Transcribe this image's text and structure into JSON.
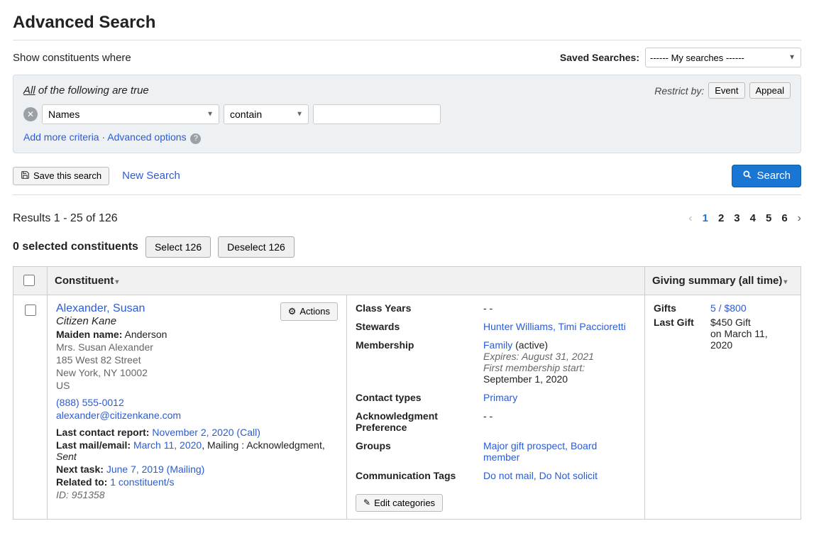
{
  "header": {
    "title": "Advanced Search",
    "show_label": "Show constituents where",
    "saved_label": "Saved Searches:",
    "saved_placeholder": "------ My searches ------"
  },
  "criteria": {
    "all_text_prefix": "All",
    "all_text_rest": " of the following are true",
    "restrict_label": "Restrict by:",
    "restrict_event": "Event",
    "restrict_appeal": "Appeal",
    "field": "Names",
    "operator": "contain",
    "value": "",
    "add_more": "Add more criteria",
    "adv_options": "Advanced options"
  },
  "actions": {
    "save_search": "Save this search",
    "new_search": "New Search",
    "search": "Search"
  },
  "results": {
    "summary": "Results 1 - 25 of 126",
    "pages": [
      "1",
      "2",
      "3",
      "4",
      "5",
      "6"
    ],
    "current_page": "1",
    "selected_count_label": "0 selected constituents",
    "select_all": "Select 126",
    "deselect_all": "Deselect 126"
  },
  "table": {
    "col_constituent": "Constituent",
    "col_giving": "Giving summary (all time)"
  },
  "row1": {
    "name": "Alexander, Susan",
    "org": "Citizen Kane",
    "maiden_label": "Maiden name:",
    "maiden_value": "Anderson",
    "salutation": "Mrs. Susan Alexander",
    "addr1": "185 West 82 Street",
    "addr2": "New York, NY 10002",
    "addr3": "US",
    "phone": "(888) 555-0012",
    "email": "alexander@citizenkane.com",
    "lcr_label": "Last contact report:",
    "lcr_value": "November 2, 2020 (Call)",
    "lme_label": "Last mail/email:",
    "lme_date": "March 11, 2020",
    "lme_rest": ", Mailing : Acknowledgment, ",
    "lme_status": "Sent",
    "nt_label": "Next task:",
    "nt_value": "June 7, 2019 (Mailing)",
    "rel_label": "Related to:",
    "rel_value": "1 constituent/s",
    "id_label": "ID: 951358",
    "actions_label": "Actions",
    "details": {
      "class_years_k": "Class Years",
      "class_years_v": "- -",
      "stewards_k": "Stewards",
      "stewards_v": "Hunter Williams, Timi Paccioretti",
      "membership_k": "Membership",
      "membership_link": "Family",
      "membership_status": " (active)",
      "membership_exp": "Expires: August 31, 2021",
      "membership_first_lbl": "First membership start:",
      "membership_first_val": "September 1, 2020",
      "contact_types_k": "Contact types",
      "contact_types_v": "Primary",
      "ack_k": "Acknowledgment Preference",
      "ack_v": "- -",
      "groups_k": "Groups",
      "groups_v": "Major gift prospect, Board member",
      "comm_k": "Communication Tags",
      "comm_v": "Do not mail, Do Not solicit",
      "edit_categories": "Edit categories"
    },
    "giving": {
      "gifts_k": "Gifts",
      "gifts_v": "5 / $800",
      "last_k": "Last Gift",
      "last_amount": "$450 Gift",
      "last_date": "on March 11, 2020"
    }
  }
}
